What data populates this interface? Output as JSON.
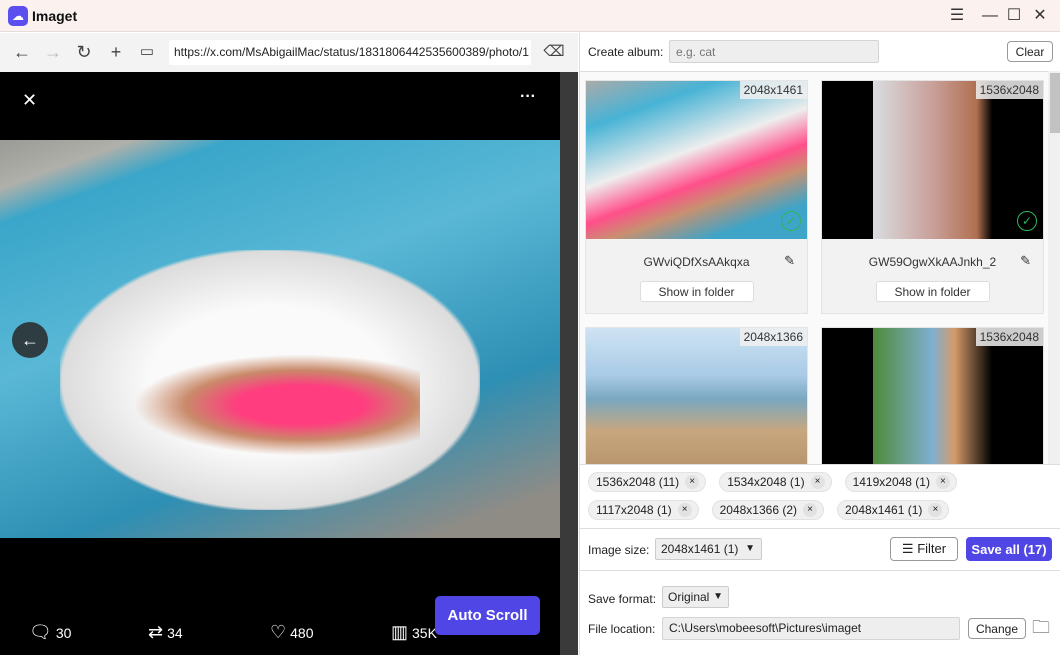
{
  "app": {
    "title": "Imaget",
    "accent": "#5046e5"
  },
  "browser": {
    "url": "https://x.com/MsAbigailMac/status/1831806442535600389/photo/1"
  },
  "viewer": {
    "stats": {
      "replies": "30",
      "reposts": "34",
      "likes": "480",
      "views": "35K"
    },
    "auto_scroll_label": "Auto Scroll"
  },
  "album": {
    "label": "Create album:",
    "placeholder": "e.g. cat",
    "clear_label": "Clear"
  },
  "cards": [
    {
      "dims": "2048x1461",
      "name": "GWviQDfXsAAkqxa",
      "button": "Show in folder",
      "downloaded": true
    },
    {
      "dims": "1536x2048",
      "name": "GW59OgwXkAAJnkh_2",
      "button": "Show in folder",
      "downloaded": true
    },
    {
      "dims": "2048x1366",
      "downloaded": true
    },
    {
      "dims": "1536x2048",
      "downloaded": true
    }
  ],
  "chips": [
    "1536x2048 (11)",
    "1534x2048 (1)",
    "1419x2048 (1)",
    "1117x2048 (1)",
    "2048x1366 (2)",
    "2048x1461 (1)"
  ],
  "image_size": {
    "label": "Image size:",
    "value": "2048x1461 (1)",
    "filter_label": "Filter",
    "save_all_label": "Save all (17)"
  },
  "save_format": {
    "label": "Save format:",
    "value": "Original"
  },
  "file_location": {
    "label": "File location:",
    "value": "C:\\Users\\mobeesoft\\Pictures\\imaget",
    "change_label": "Change"
  }
}
